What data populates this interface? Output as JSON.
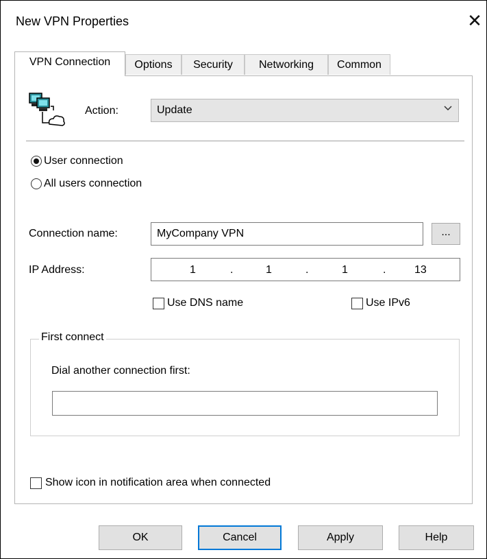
{
  "window": {
    "title": "New VPN Properties",
    "close_glyph": "✕"
  },
  "tabs": [
    {
      "label": "VPN Connection",
      "active": true
    },
    {
      "label": "Options",
      "active": false
    },
    {
      "label": "Security",
      "active": false
    },
    {
      "label": "Networking",
      "active": false
    },
    {
      "label": "Common",
      "active": false
    }
  ],
  "vpn": {
    "icon": "vpn-network-icon",
    "action_label": "Action:",
    "action_value": "Update",
    "radios": [
      {
        "label": "User connection",
        "selected": true
      },
      {
        "label": "All users connection",
        "selected": false
      }
    ],
    "connection_name_label": "Connection name:",
    "connection_name_value": "MyCompany VPN",
    "browse_label": "...",
    "ip_label": "IP Address:",
    "ip_octets": [
      "1",
      "1",
      "1",
      "13"
    ],
    "ip_dot": ".",
    "use_dns_label": "Use DNS name",
    "use_ipv6_label": "Use IPv6",
    "first_connect_title": "First connect",
    "dial_label": "Dial another connection first:",
    "dial_value": "",
    "show_icon_label": "Show icon in notification area when connected"
  },
  "buttons": {
    "ok": "OK",
    "cancel": "Cancel",
    "apply": "Apply",
    "help": "Help"
  },
  "colors": {
    "accent": "#0078d7",
    "button_bg": "#e1e1e1",
    "select_bg": "#e5e5e5"
  }
}
